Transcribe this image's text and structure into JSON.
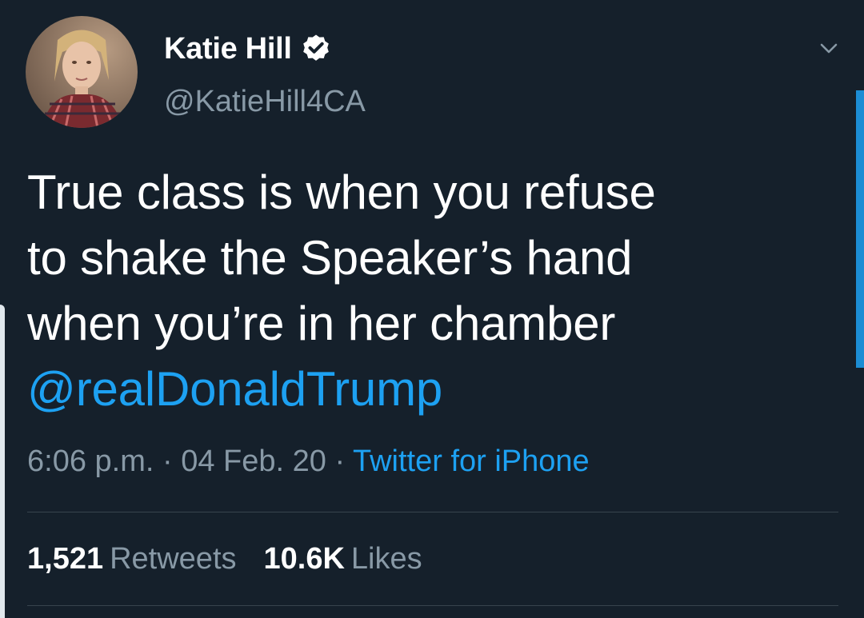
{
  "tweet": {
    "display_name": "Katie Hill",
    "handle": "@KatieHill4CA",
    "verified": true,
    "text_lines": [
      "True class is when you refuse",
      "to shake the Speaker’s hand",
      "when you’re in her chamber"
    ],
    "mention": "@realDonaldTrump",
    "time": "6:06 p.m.",
    "separator_1": " · ",
    "date": "04 Feb. 20",
    "separator_2": " · ",
    "source": "Twitter for iPhone",
    "stats": {
      "retweets_count": "1,521",
      "retweets_label": "Retweets",
      "likes_count": "10.6K",
      "likes_label": "Likes"
    }
  },
  "icons": {
    "verified": "verified-badge-icon",
    "more": "chevron-down-icon",
    "avatar": "avatar-photo"
  },
  "colors": {
    "background": "#15202b",
    "accent": "#1da1f2",
    "secondary_text": "#8899a6",
    "divider": "#38444d"
  }
}
